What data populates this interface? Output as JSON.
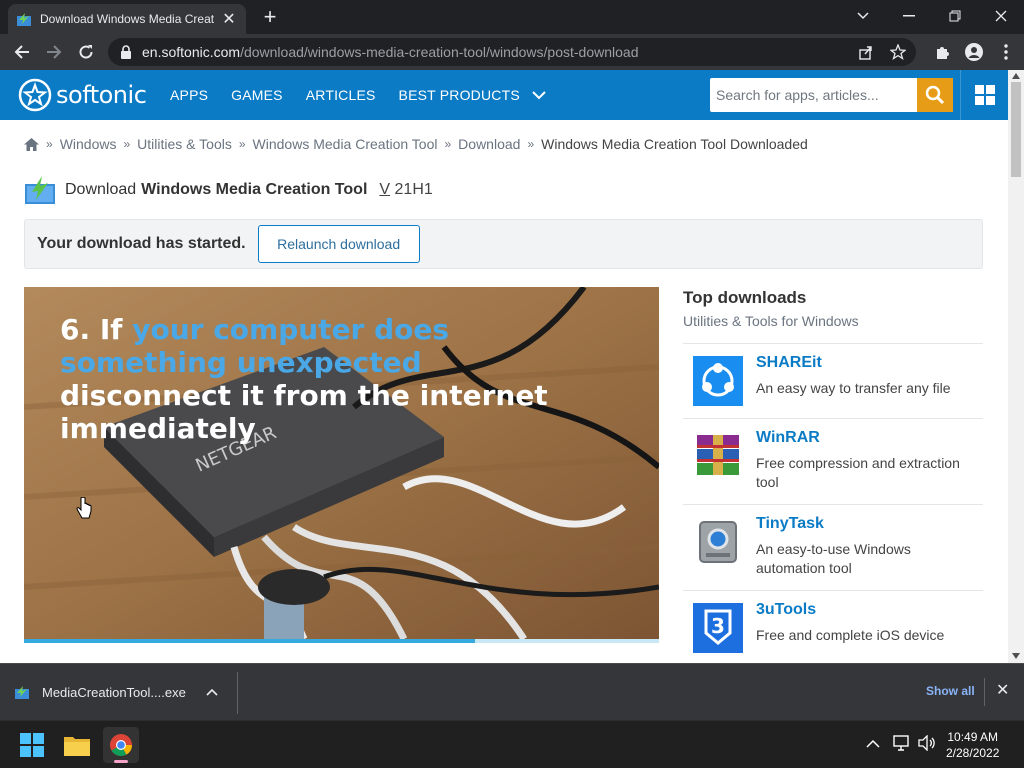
{
  "browser": {
    "tab_title": "Download Windows Media Creat",
    "tab_close": "✕",
    "new_tab": "+",
    "url_host": "en.softonic.com",
    "url_path": "/download/windows-media-creation-tool/windows/post-download",
    "window_controls": [
      "chevron-down-icon",
      "minimize-icon",
      "restore-icon",
      "close-icon"
    ]
  },
  "site": {
    "logo_text": "softonic",
    "nav": [
      "APPS",
      "GAMES",
      "ARTICLES",
      "BEST PRODUCTS"
    ],
    "search_placeholder": "Search for apps, articles...",
    "brand_color": "#0b7bc6",
    "accent_color": "#e79c17"
  },
  "breadcrumb": {
    "items": [
      "Windows",
      "Utilities & Tools",
      "Windows Media Creation Tool",
      "Download"
    ],
    "current": "Windows Media Creation Tool Downloaded",
    "separator": "»"
  },
  "download": {
    "prefix": "Download",
    "app_name": "Windows Media Creation Tool",
    "version_label": "V",
    "version": "21H1",
    "started_text": "Your download has started.",
    "relaunch_label": "Relaunch download"
  },
  "video": {
    "caption_number": "6. If ",
    "caption_highlight": "your computer does something unexpected",
    "caption_rest": " disconnect it from the internet immediately",
    "progress": 0.71
  },
  "sidebar": {
    "title": "Top downloads",
    "subtitle": "Utilities & Tools for Windows",
    "items": [
      {
        "name": "SHAREit",
        "desc": "An easy way to transfer any file",
        "icon": "shareit-icon"
      },
      {
        "name": "WinRAR",
        "desc": "Free compression and extraction tool",
        "icon": "winrar-icon"
      },
      {
        "name": "TinyTask",
        "desc": "An easy-to-use Windows automation tool",
        "icon": "tinytask-icon"
      },
      {
        "name": "3uTools",
        "desc": "Free and complete iOS device",
        "icon": "3utools-icon"
      }
    ]
  },
  "download_shelf": {
    "file_name": "MediaCreationTool....exe",
    "show_all": "Show all",
    "close": "✕"
  },
  "taskbar": {
    "time": "10:49 AM",
    "date": "2/28/2022",
    "apps": [
      "windows-start-icon",
      "file-explorer-icon",
      "chrome-icon"
    ]
  }
}
